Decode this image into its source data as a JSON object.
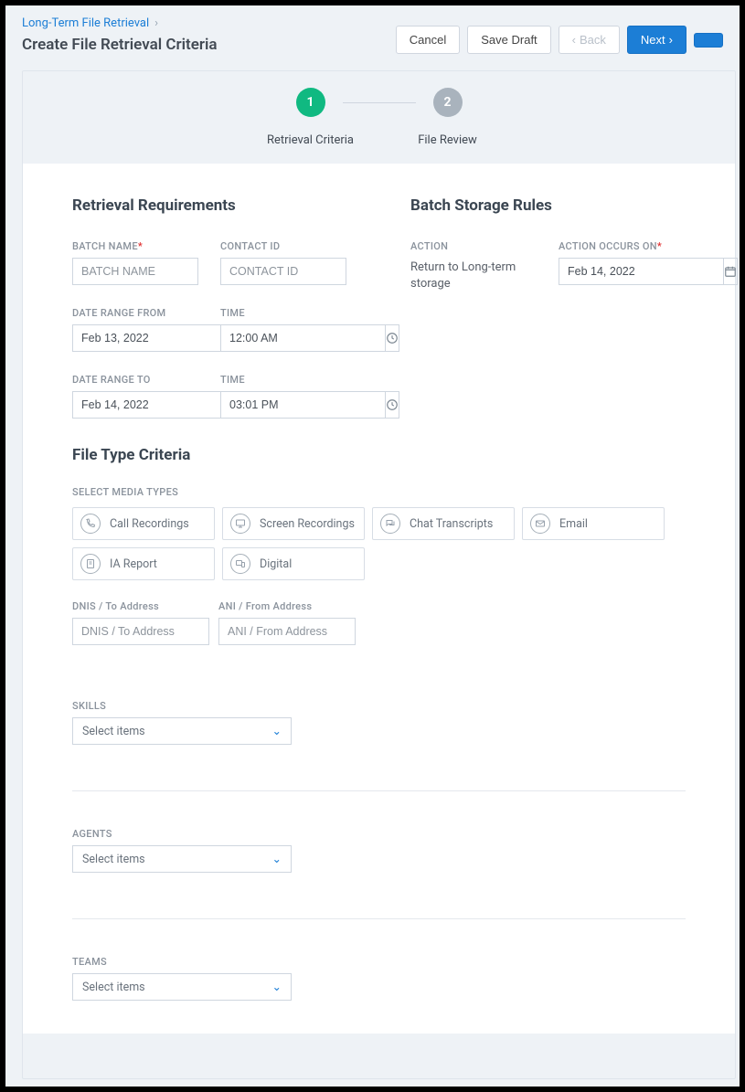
{
  "breadcrumb": {
    "parent": "Long-Term File Retrieval"
  },
  "page_title": "Create File Retrieval Criteria",
  "toolbar": {
    "cancel": "Cancel",
    "save_draft": "Save Draft",
    "back": "Back",
    "next": "Next"
  },
  "wizard": {
    "step1": {
      "num": "1",
      "label": "Retrieval Criteria"
    },
    "step2": {
      "num": "2",
      "label": "File Review"
    }
  },
  "sections": {
    "retrieval_requirements": "Retrieval Requirements",
    "batch_storage_rules": "Batch Storage Rules",
    "file_type_criteria": "File Type Criteria"
  },
  "fields": {
    "batch_name": {
      "label": "BATCH NAME",
      "placeholder": "BATCH NAME"
    },
    "contact_id": {
      "label": "CONTACT ID",
      "placeholder": "CONTACT ID"
    },
    "date_from": {
      "label": "DATE RANGE FROM",
      "value": "Feb 13, 2022"
    },
    "time_from": {
      "label": "TIME",
      "value": "12:00 AM"
    },
    "date_to": {
      "label": "DATE RANGE TO",
      "value": "Feb 14, 2022"
    },
    "time_to": {
      "label": "TIME",
      "value": "03:01 PM"
    },
    "action": {
      "label": "ACTION",
      "value": "Return to Long-term storage"
    },
    "action_occurs": {
      "label": "ACTION OCCURS ON",
      "value": "Feb 14, 2022"
    },
    "media_types_label": "SELECT MEDIA TYPES",
    "dnis": {
      "label": "DNIS / To Address",
      "placeholder": "DNIS / To Address"
    },
    "ani": {
      "label": "ANI / From Address",
      "placeholder": "ANI / From Address"
    },
    "skills": {
      "label": "SKILLS",
      "placeholder": "Select items"
    },
    "agents": {
      "label": "AGENTS",
      "placeholder": "Select items"
    },
    "teams": {
      "label": "TEAMS",
      "placeholder": "Select items"
    }
  },
  "media_types": {
    "call": "Call Recordings",
    "screen": "Screen Recordings",
    "chat": "Chat Transcripts",
    "email": "Email",
    "ia": "IA Report",
    "digital": "Digital"
  }
}
